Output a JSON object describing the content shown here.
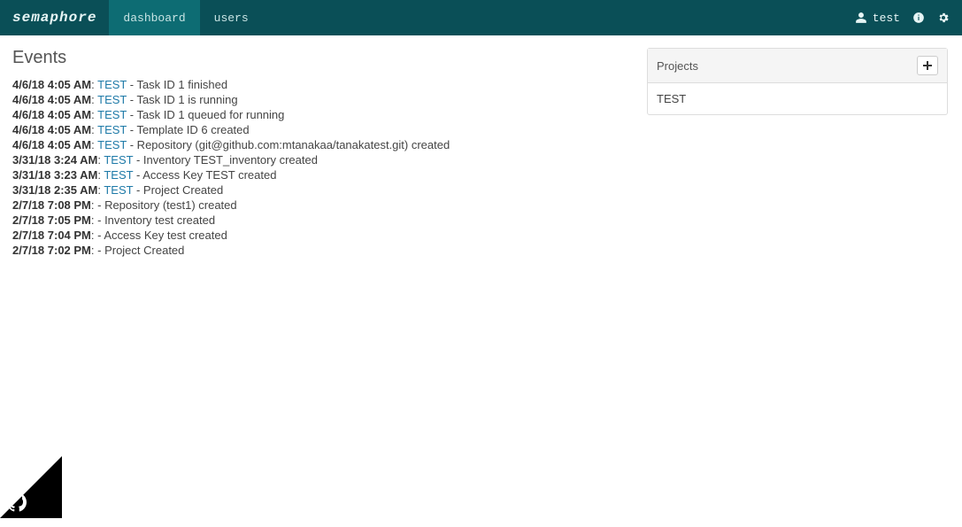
{
  "brand": "semaphore",
  "nav": {
    "dashboard": "dashboard",
    "users": "users",
    "username": "test"
  },
  "events_title": "Events",
  "projects_title": "Projects",
  "projects": [
    {
      "name": "TEST"
    }
  ],
  "events": [
    {
      "time": "4/6/18 4:05 AM",
      "project": "TEST",
      "desc": "Task ID 1 finished"
    },
    {
      "time": "4/6/18 4:05 AM",
      "project": "TEST",
      "desc": "Task ID 1 is running"
    },
    {
      "time": "4/6/18 4:05 AM",
      "project": "TEST",
      "desc": "Task ID 1 queued for running"
    },
    {
      "time": "4/6/18 4:05 AM",
      "project": "TEST",
      "desc": "Template ID 6 created"
    },
    {
      "time": "4/6/18 4:05 AM",
      "project": "TEST",
      "desc": "Repository (git@github.com:mtanakaa/tanakatest.git) created"
    },
    {
      "time": "3/31/18 3:24 AM",
      "project": "TEST",
      "desc": "Inventory TEST_inventory created"
    },
    {
      "time": "3/31/18 3:23 AM",
      "project": "TEST",
      "desc": "Access Key TEST created"
    },
    {
      "time": "3/31/18 2:35 AM",
      "project": "TEST",
      "desc": "Project Created"
    },
    {
      "time": "2/7/18 7:08 PM",
      "project": "",
      "desc": "Repository (test1) created"
    },
    {
      "time": "2/7/18 7:05 PM",
      "project": "",
      "desc": "Inventory test created"
    },
    {
      "time": "2/7/18 7:04 PM",
      "project": "",
      "desc": "Access Key test created"
    },
    {
      "time": "2/7/18 7:02 PM",
      "project": "",
      "desc": "Project Created"
    }
  ]
}
